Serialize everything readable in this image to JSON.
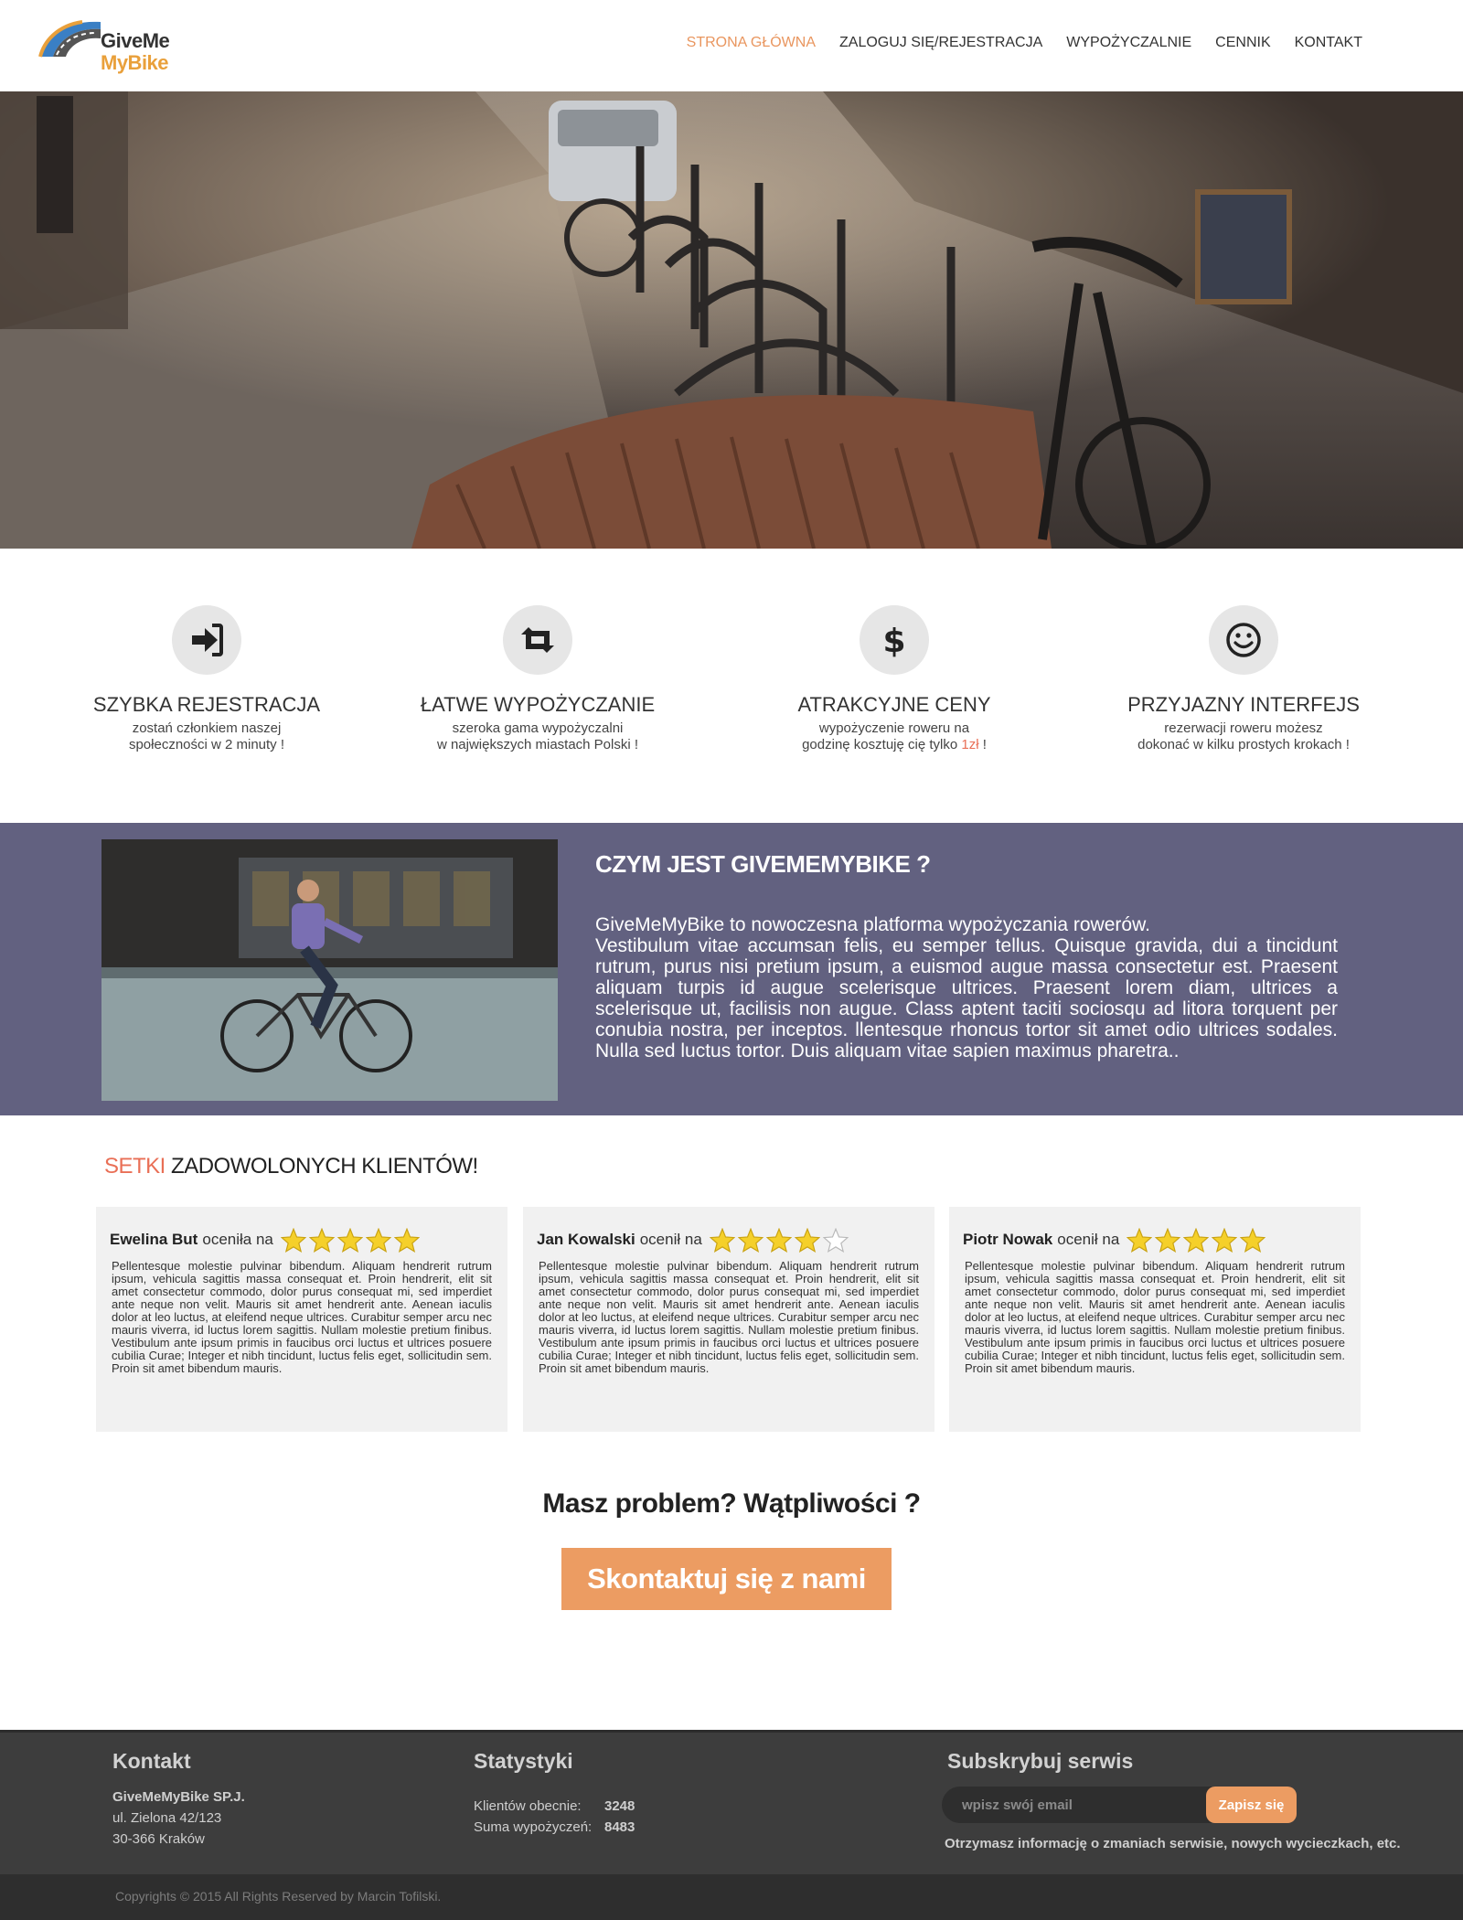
{
  "header": {
    "logo": {
      "line1": "GiveMe",
      "line2": "MyBike"
    },
    "nav": [
      {
        "label": "STRONA GŁÓWNA",
        "active": true
      },
      {
        "label": "ZALOGUJ SIĘ/REJESTRACJA"
      },
      {
        "label": "WYPOŻYCZALNIE"
      },
      {
        "label": "CENNIK"
      },
      {
        "label": "KONTAKT"
      }
    ]
  },
  "features": [
    {
      "icon": "sign-in-icon",
      "title": "SZYBKA REJESTRACJA",
      "line1": "zostań członkiem naszej",
      "line2": "społeczności w 2 minuty !"
    },
    {
      "icon": "retweet-icon",
      "title": "ŁATWE WYPOŻYCZANIE",
      "line1": "szeroka gama wypożyczalni",
      "line2": "w największych miastach Polski !"
    },
    {
      "icon": "dollar-icon",
      "title": "ATRAKCYJNE CENY",
      "line1": "wypożyczenie roweru na",
      "line2_pre": "godzinę kosztuję cię tylko ",
      "line2_price": "1zł",
      "line2_post": " !"
    },
    {
      "icon": "smile-icon",
      "title": "PRZYJAZNY INTERFEJS",
      "line1": "rezerwacji roweru możesz",
      "line2": "dokonać w kilku prostych krokach !"
    }
  ],
  "about": {
    "title": "CZYM JEST GIVEMEMYBIKE ?",
    "lead": "GiveMeMyBike to nowoczesna platforma wypożyczania rowerów.",
    "body": "Vestibulum vitae accumsan felis, eu semper tellus. Quisque gravida, dui a tincidunt rutrum, purus nisi pretium ipsum, a euismod augue massa consectetur est. Praesent aliquam turpis id augue scelerisque ultrices. Praesent lorem diam, ultrices a scelerisque ut, facilisis non augue. Class aptent taciti sociosqu ad litora torquent per conubia nostra, per inceptos. llentesque rhoncus tortor sit amet odio ultrices sodales. Nulla sed luctus tortor. Duis aliquam vitae sapien maximus pharetra.."
  },
  "testimonials": {
    "title_accent": "SETKI",
    "title_rest": " ZADOWOLONYCH KLIENTÓW!",
    "reviews": [
      {
        "name": "Ewelina But",
        "verb": "oceniła na",
        "rating": 5,
        "text": "Pellentesque molestie pulvinar bibendum. Aliquam hendrerit rutrum ipsum, vehicula sagittis massa consequat et. Proin hendrerit, elit sit amet consectetur commodo, dolor purus consequat mi, sed imperdiet ante neque non velit. Mauris sit amet hendrerit ante. Aenean iaculis dolor at leo luctus, at eleifend neque ultrices. Curabitur semper arcu nec mauris viverra, id luctus lorem sagittis. Nullam molestie pretium finibus. Vestibulum ante ipsum primis in faucibus orci luctus et ultrices posuere cubilia Curae; Integer et nibh tincidunt, luctus felis eget, sollicitudin sem. Proin sit amet bibendum mauris."
      },
      {
        "name": "Jan Kowalski",
        "verb": "ocenił na",
        "rating": 4,
        "text": "Pellentesque molestie pulvinar bibendum. Aliquam hendrerit rutrum ipsum, vehicula sagittis massa consequat et. Proin hendrerit, elit sit amet consectetur commodo, dolor purus consequat mi, sed imperdiet ante neque non velit. Mauris sit amet hendrerit ante. Aenean iaculis dolor at leo luctus, at eleifend neque ultrices. Curabitur semper arcu nec mauris viverra, id luctus lorem sagittis. Nullam molestie pretium finibus. Vestibulum ante ipsum primis in faucibus orci luctus et ultrices posuere cubilia Curae; Integer et nibh tincidunt, luctus felis eget, sollicitudin sem. Proin sit amet bibendum mauris."
      },
      {
        "name": "Piotr Nowak",
        "verb": "ocenił na",
        "rating": 5,
        "text": "Pellentesque molestie pulvinar bibendum. Aliquam hendrerit rutrum ipsum, vehicula sagittis massa consequat et. Proin hendrerit, elit sit amet consectetur commodo, dolor purus consequat mi, sed imperdiet ante neque non velit. Mauris sit amet hendrerit ante. Aenean iaculis dolor at leo luctus, at eleifend neque ultrices. Curabitur semper arcu nec mauris viverra, id luctus lorem sagittis. Nullam molestie pretium finibus. Vestibulum ante ipsum primis in faucibus orci luctus et ultrices posuere cubilia Curae; Integer et nibh tincidunt, luctus felis eget, sollicitudin sem. Proin sit amet bibendum mauris."
      }
    ]
  },
  "cta": {
    "question": "Masz problem? Wątpliwości ?",
    "button": "Skontaktuj się z nami"
  },
  "footer": {
    "contact": {
      "title": "Kontakt",
      "company": "GiveMeMyBike SP.J.",
      "street": "ul. Zielona 42/123",
      "city": "30-366 Kraków"
    },
    "stats": {
      "title": "Statystyki",
      "clients_label": "Klientów obecnie:",
      "clients_value": "3248",
      "rentals_label": "Suma wypożyczeń:",
      "rentals_value": "8483"
    },
    "subscribe": {
      "title": "Subskrybuj serwis",
      "placeholder": "wpisz swój email",
      "button": "Zapisz się",
      "note": "Otrzymasz informację o zmaniach serwisie, nowych wycieczkach, etc."
    },
    "copyright": "Copyrights © 2015 All Rights Reserved by Marcin Tofilski."
  },
  "colors": {
    "accent": "#ec9c62",
    "nav_active": "#e9965f",
    "about_bg": "#626180",
    "footer_bg": "#3d3d3d",
    "star": "#f5d02a",
    "price_accent": "#e96f56"
  }
}
